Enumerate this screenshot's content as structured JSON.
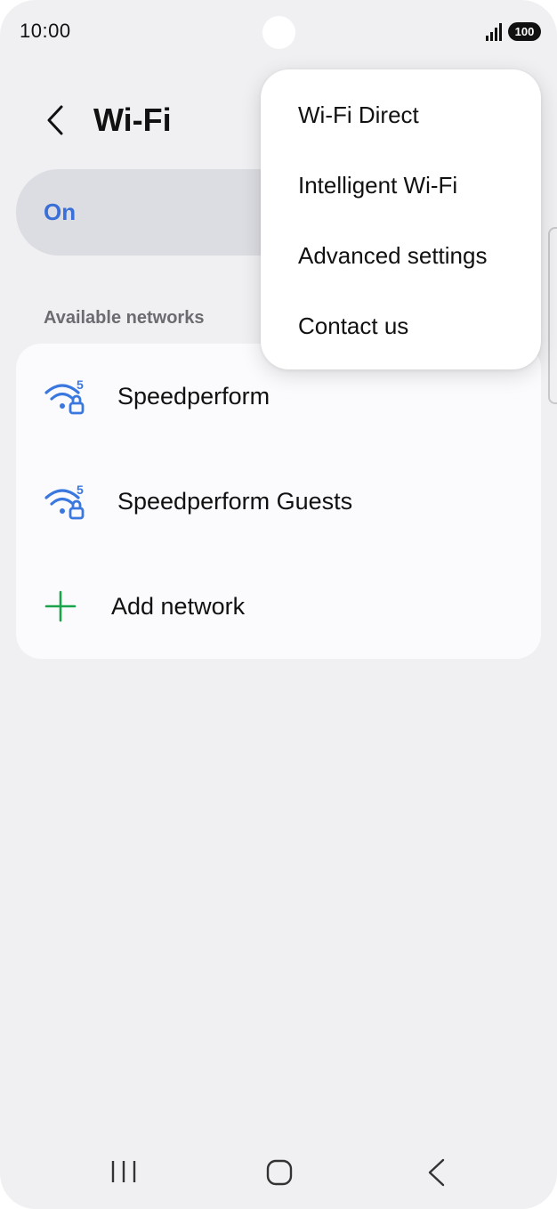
{
  "status_bar": {
    "time": "10:00",
    "battery": "100",
    "signal_icon": "cellular-signal-icon"
  },
  "header": {
    "back_icon": "chevron-left-icon",
    "title": "Wi-Fi"
  },
  "toggle": {
    "label": "On",
    "accent_color": "#3a6fd8"
  },
  "available_networks": {
    "section_title": "Available networks",
    "networks": [
      {
        "name": "Speedperform",
        "icon": "wifi-5ghz-locked-icon"
      },
      {
        "name": "Speedperform Guests",
        "icon": "wifi-5ghz-locked-icon"
      }
    ],
    "add_network_label": "Add network",
    "add_icon_color": "#1aa34a"
  },
  "menu": {
    "items": [
      {
        "label": "Wi-Fi Direct"
      },
      {
        "label": "Intelligent Wi-Fi"
      },
      {
        "label": "Advanced settings"
      },
      {
        "label": "Contact us"
      }
    ]
  },
  "nav_bar": {
    "recents_icon": "recents-icon",
    "home_icon": "home-icon",
    "back_icon": "back-icon"
  }
}
